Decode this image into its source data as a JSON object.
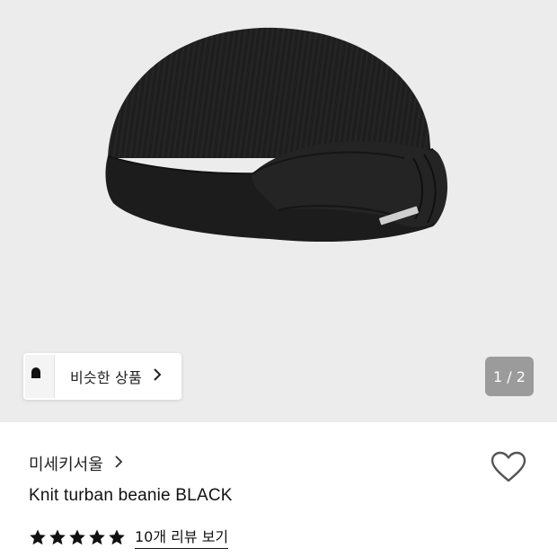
{
  "gallery": {
    "similar_products_label": "비슷한 상품",
    "page_indicator": "1 / 2",
    "current_image": 1,
    "total_images": 2
  },
  "product": {
    "brand": "미세키서울",
    "title": "Knit turban beanie BLACK",
    "rating_stars": 5,
    "review_link": "10개 리뷰 보기"
  },
  "icons": {
    "chip_chevron": "chevron-right-icon",
    "brand_chevron": "chevron-right-icon",
    "wishlist": "heart-outline-icon",
    "star": "star-filled-icon"
  },
  "colors": {
    "hero_bg": "#ececec",
    "indicator_bg": "#9b9b9b",
    "text": "#111111"
  }
}
